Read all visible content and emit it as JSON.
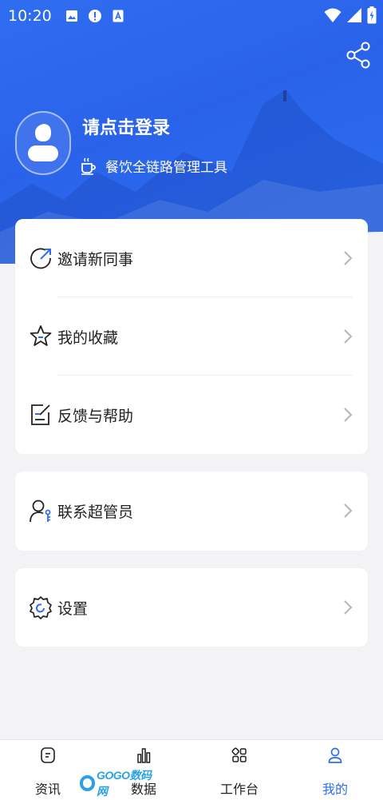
{
  "status_bar": {
    "time": "10:20"
  },
  "profile": {
    "login_prompt": "请点击登录",
    "tagline": "餐饮全链路管理工具"
  },
  "menu": {
    "invite": "邀请新同事",
    "favorites": "我的收藏",
    "feedback": "反馈与帮助",
    "contact_admin": "联系超管员",
    "settings": "设置"
  },
  "tabs": [
    {
      "label": "资讯"
    },
    {
      "label": "数据"
    },
    {
      "label": "工作台"
    },
    {
      "label": "我的"
    }
  ],
  "watermark": {
    "text": "GOGO数码网"
  },
  "colors": {
    "accent": "#2d6df0",
    "hero": "#2a63ea"
  }
}
